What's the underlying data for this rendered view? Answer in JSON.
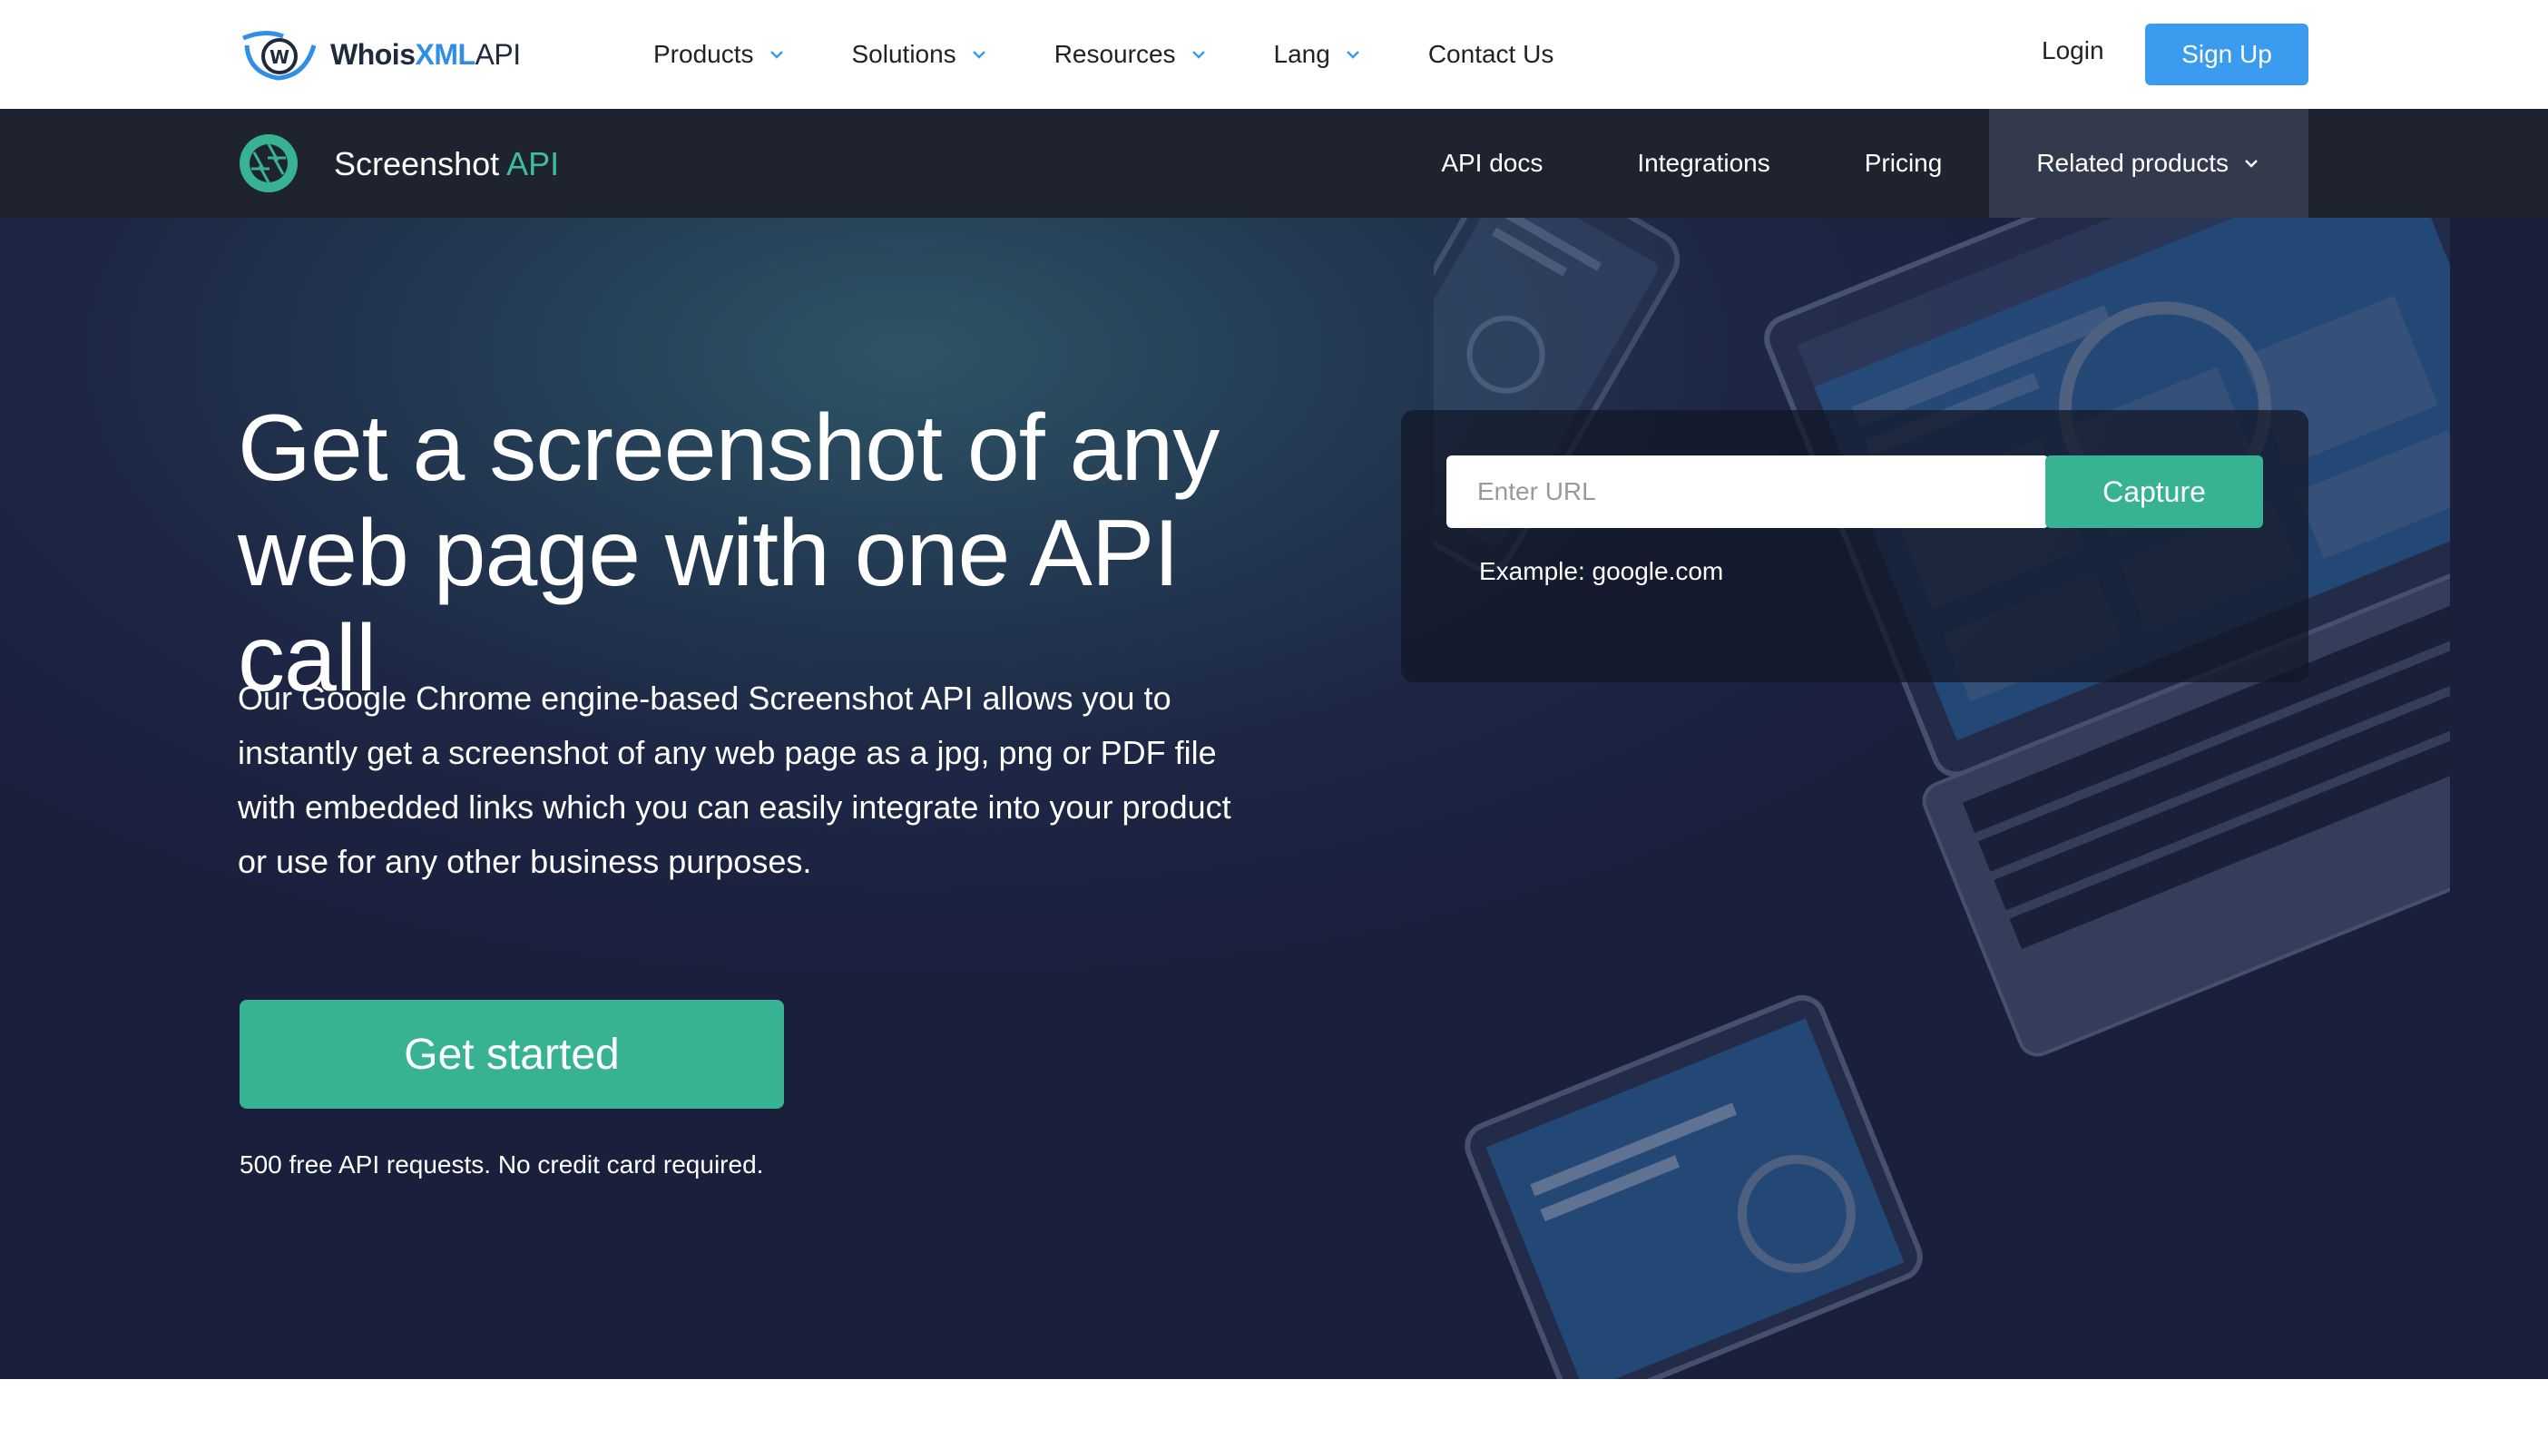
{
  "topnav": {
    "logo": {
      "whois": "Whois",
      "xml": "XML",
      "api": "API"
    },
    "links": [
      {
        "label": "Products",
        "has_dropdown": true
      },
      {
        "label": "Solutions",
        "has_dropdown": true
      },
      {
        "label": "Resources",
        "has_dropdown": true
      },
      {
        "label": "Lang",
        "has_dropdown": true
      },
      {
        "label": "Contact Us",
        "has_dropdown": false
      }
    ],
    "login": "Login",
    "signup": "Sign Up"
  },
  "subnav": {
    "product_name": "Screenshot",
    "product_suffix": "API",
    "links": [
      {
        "label": "API docs"
      },
      {
        "label": "Integrations"
      },
      {
        "label": "Pricing"
      },
      {
        "label": "Related products",
        "has_dropdown": true,
        "active": true
      }
    ]
  },
  "hero": {
    "headline_line1": "Get a screenshot of any",
    "headline_line2": "web page with one API call",
    "lead": "Our Google Chrome engine-based Screenshot API allows you to instantly get a screenshot of any web page as a jpg, png or PDF file with embedded links which you can easily integrate into your product or use for any other business purposes.",
    "cta": "Get started",
    "cta_note": "500 free API requests. No credit card required."
  },
  "capture": {
    "placeholder": "Enter URL",
    "value": "",
    "button": "Capture",
    "example": "Example: google.com"
  },
  "colors": {
    "brand_blue": "#3a9bef",
    "brand_green": "#37b393",
    "subnav_bg": "#1f232f",
    "hero_bg": "#1d2745"
  },
  "icons": [
    "whoisxmlapi-logo-icon",
    "chevron-down-icon",
    "camera-shutter-icon"
  ]
}
